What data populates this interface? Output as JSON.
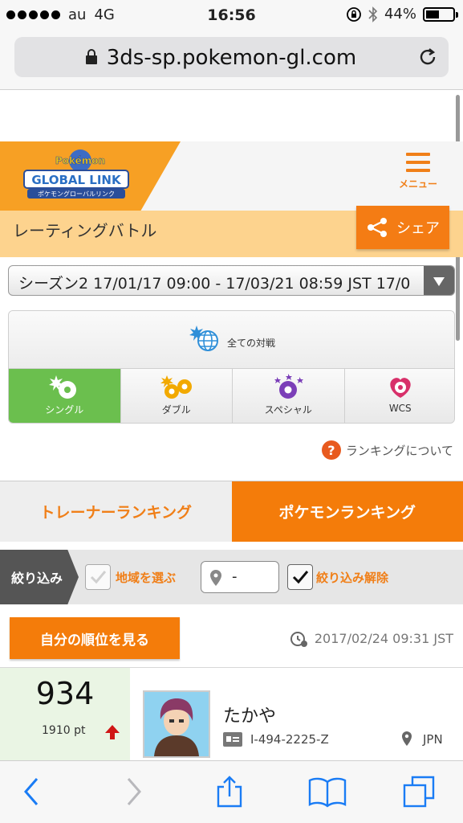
{
  "status_bar": {
    "carrier": "au",
    "network": "4G",
    "time": "16:56",
    "battery": "44%"
  },
  "browser": {
    "url": "3ds-sp.pokemon-gl.com"
  },
  "header": {
    "menu_label": "メニュー",
    "page_title": "レーティングバトル",
    "share_label": "シェア",
    "accent_color": "#f47c0a"
  },
  "season": {
    "selected": "シーズン2 17/01/17 09:00 - 17/03/21 08:59 JST 17/0"
  },
  "battle_types": {
    "all_label": "全ての対戦",
    "items": [
      {
        "label": "シングル",
        "active": true
      },
      {
        "label": "ダブル",
        "active": false
      },
      {
        "label": "スペシャル",
        "active": false
      },
      {
        "label": "WCS",
        "active": false
      }
    ]
  },
  "about_ranking": "ランキングについて",
  "tabs": {
    "trainer": "トレーナーランキング",
    "pokemon": "ポケモンランキング"
  },
  "filter": {
    "label": "絞り込み",
    "region_label": "地域を選ぶ",
    "region_checked": false,
    "location_value": "-",
    "release_label": "絞り込み解除",
    "release_checked": true
  },
  "my_rank_button": "自分の順位を見る",
  "updated_at": "2017/02/24 09:31 JST",
  "ranking": [
    {
      "rank": "934",
      "points": "1910 pt",
      "trend": "up",
      "name": "たかや",
      "player_id": "I-494-2225-Z",
      "country": "JPN"
    }
  ]
}
